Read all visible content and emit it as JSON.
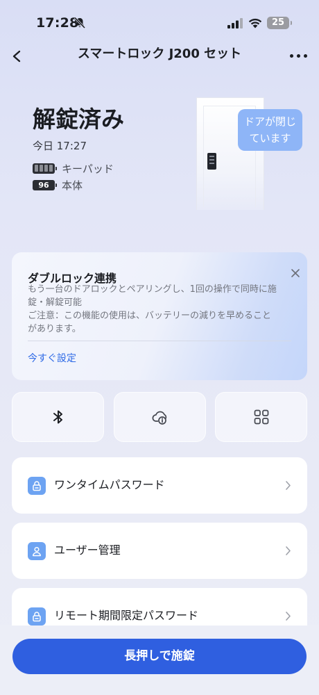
{
  "status_bar": {
    "time": "17:28",
    "battery": "25",
    "icons": [
      "bell-slash-icon",
      "signal-icon",
      "wifi-icon",
      "battery-icon"
    ]
  },
  "nav": {
    "title": "スマートロック J200 セット",
    "back_icon": "chevron-left-icon",
    "more_icon": "more-horizontal-icon"
  },
  "lock": {
    "status": "解錠済み",
    "time": "今日 17:27",
    "batteries": [
      {
        "label": "キーパッド",
        "level_text": ""
      },
      {
        "label": "本体",
        "level_text": "96"
      }
    ]
  },
  "door": {
    "bubble_line1": "ドアが閉じ",
    "bubble_line2": "ています"
  },
  "promo": {
    "title": "ダブルロック連携",
    "description_line1": "もう一台のドアロックとペアリングし、1回の操作で同時に施",
    "description_line2": "錠・解錠可能",
    "note_line1": "ご注意：この機能の使用は、バッテリーの減りを早めること",
    "note_line2": "があります。",
    "link": "今すぐ設定",
    "close_icon": "close-icon"
  },
  "quick_actions": [
    {
      "icon": "bluetooth-icon"
    },
    {
      "icon": "cloud-info-icon"
    },
    {
      "icon": "grid-icon"
    }
  ],
  "menu": [
    {
      "label": "ワンタイムパスワード",
      "icon": "lock-icon"
    },
    {
      "label": "ユーザー管理",
      "icon": "user-icon"
    },
    {
      "label": "リモート期間限定パスワード",
      "icon": "lock-icon"
    }
  ],
  "cta": {
    "label": "長押しで施錠"
  },
  "colors": {
    "accent": "#2f5fe0",
    "link": "#2e6ae6",
    "icon_tile": "#6da3f2",
    "bubble": "#8eb5f7"
  }
}
